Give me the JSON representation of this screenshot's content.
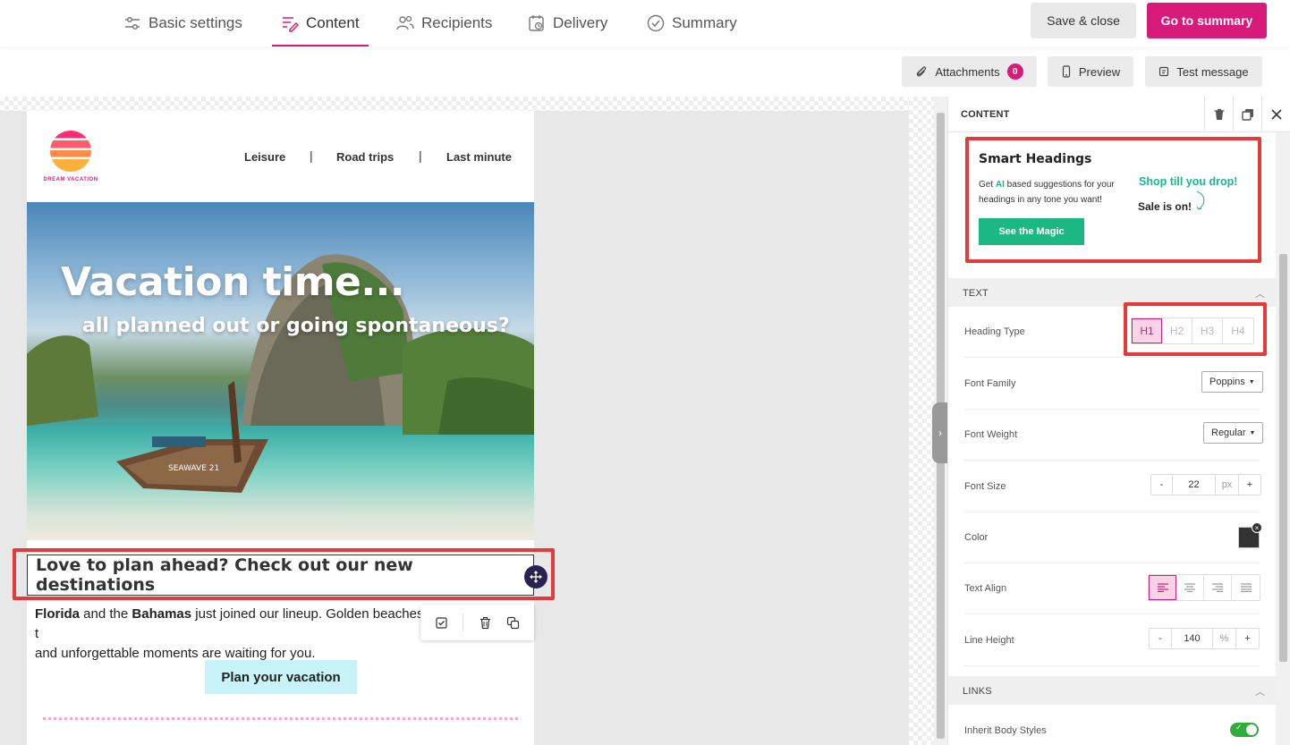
{
  "topnav": {
    "tabs": [
      {
        "label": "Basic settings",
        "icon": "sliders-icon"
      },
      {
        "label": "Content",
        "icon": "content-edit-icon",
        "active": true
      },
      {
        "label": "Recipients",
        "icon": "users-icon"
      },
      {
        "label": "Delivery",
        "icon": "calendar-clock-icon"
      },
      {
        "label": "Summary",
        "icon": "check-circle-icon"
      }
    ],
    "save_close": "Save & close",
    "go_summary": "Go to summary",
    "accent": "#d81b7a"
  },
  "toolbar": {
    "attachments": "Attachments",
    "attachments_count": "0",
    "preview": "Preview",
    "test_message": "Test message"
  },
  "email": {
    "logo_text": "DREAM VACATION",
    "nav": [
      "Leisure",
      "Road trips",
      "Last minute"
    ],
    "separator": "|",
    "hero_title": "Vacation time...",
    "hero_subtitle": "all planned out or going spontaneous?",
    "boat_label": "SEAWAVE 21",
    "heading": "Love to plan ahead? Check out our new destinations",
    "body": {
      "bold1": "Florida",
      "text1": " and the ",
      "bold2": "Bahamas",
      "text2": " just joined our lineup. Golden beaches, t",
      "line2": "and unforgettable moments are waiting for you."
    },
    "cta": "Plan your vacation"
  },
  "panel": {
    "title": "CONTENT",
    "smart": {
      "title": "Smart Headings",
      "desc_pre": "Get ",
      "desc_ai": "AI",
      "desc_post": " based suggestions for your headings in any tone you want!",
      "button": "See the Magic",
      "example1": "Shop till you drop!",
      "example2": "Sale is on!"
    },
    "text_section": "TEXT",
    "heading_type_label": "Heading Type",
    "heading_types": [
      "H1",
      "H2",
      "H3",
      "H4"
    ],
    "font_family_label": "Font Family",
    "font_family": "Poppins",
    "font_weight_label": "Font Weight",
    "font_weight": "Regular",
    "font_size_label": "Font Size",
    "font_size": "22",
    "font_size_unit": "px",
    "color_label": "Color",
    "text_align_label": "Text Align",
    "line_height_label": "Line Height",
    "line_height": "140",
    "line_height_unit": "%",
    "minus": "-",
    "plus": "+",
    "links_section": "LINKS",
    "inherit_label": "Inherit Body Styles"
  }
}
